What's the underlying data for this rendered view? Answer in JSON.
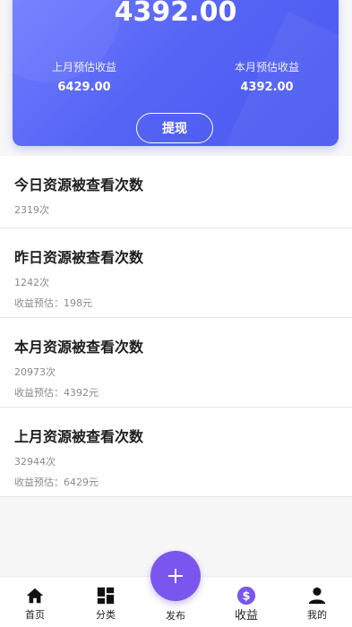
{
  "earnings": {
    "total": "4392.00",
    "last_month_label": "上月预估收益",
    "last_month_value": "6429.00",
    "this_month_label": "本月预估收益",
    "this_month_value": "4392.00",
    "withdraw_label": "提现"
  },
  "stats": [
    {
      "title": "今日资源被查看次数",
      "count": "2319次"
    },
    {
      "title": "昨日资源被查看次数",
      "count": "1242次",
      "income": "收益预估：198元"
    },
    {
      "title": "本月资源被查看次数",
      "count": "20973次",
      "income": "收益预估：4392元"
    },
    {
      "title": "上月资源被查看次数",
      "count": "32944次",
      "income": "收益预估：6429元"
    }
  ],
  "nav": {
    "home": "首页",
    "category": "分类",
    "publish": "发布",
    "income": "收益",
    "mine": "我的"
  },
  "colors": {
    "card_gradient_start": "#6f7cff",
    "card_gradient_end": "#4a58f0",
    "fab": "#7b56ee"
  }
}
